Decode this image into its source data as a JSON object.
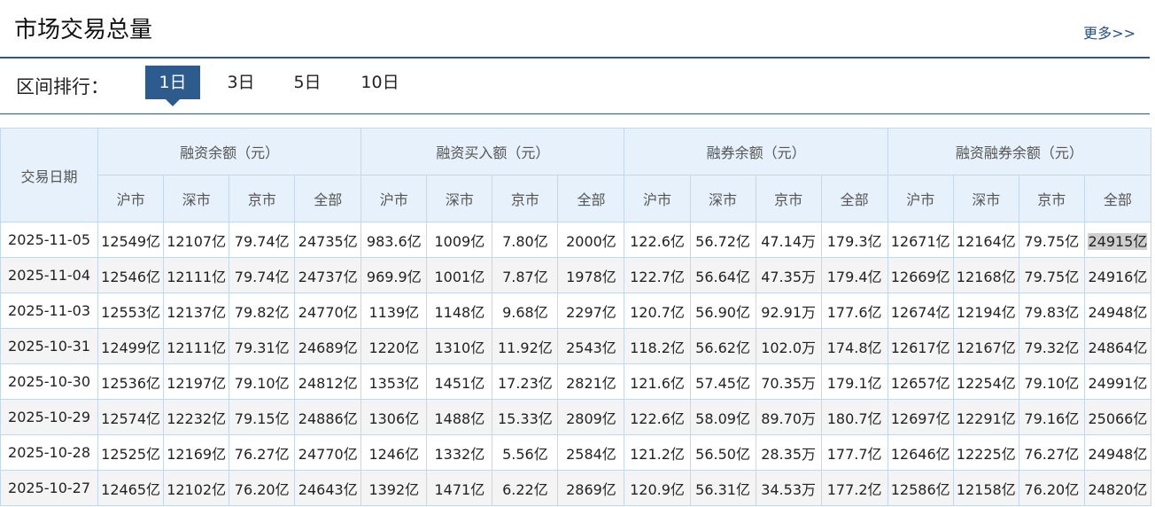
{
  "header": {
    "title": "市场交易总量",
    "more": "更多>>"
  },
  "range": {
    "label": "区间排行：",
    "tabs": [
      "1日",
      "3日",
      "5日",
      "10日"
    ],
    "active": 0
  },
  "table": {
    "date_header": "交易日期",
    "groups": [
      "融资余额（元）",
      "融资买入额（元）",
      "融券余额（元）",
      "融资融券余额（元）"
    ],
    "subheaders": [
      "沪市",
      "深市",
      "京市",
      "全部"
    ],
    "rows": [
      {
        "date": "2025-11-05",
        "values": [
          "12549亿",
          "12107亿",
          "79.74亿",
          "24735亿",
          "983.6亿",
          "1009亿",
          "7.80亿",
          "2000亿",
          "122.6亿",
          "56.72亿",
          "47.14万",
          "179.3亿",
          "12671亿",
          "12164亿",
          "79.75亿",
          "24915亿"
        ]
      },
      {
        "date": "2025-11-04",
        "values": [
          "12546亿",
          "12111亿",
          "79.74亿",
          "24737亿",
          "969.9亿",
          "1001亿",
          "7.87亿",
          "1978亿",
          "122.7亿",
          "56.64亿",
          "47.35万",
          "179.4亿",
          "12669亿",
          "12168亿",
          "79.75亿",
          "24916亿"
        ]
      },
      {
        "date": "2025-11-03",
        "values": [
          "12553亿",
          "12137亿",
          "79.82亿",
          "24770亿",
          "1139亿",
          "1148亿",
          "9.68亿",
          "2297亿",
          "120.7亿",
          "56.90亿",
          "92.91万",
          "177.6亿",
          "12674亿",
          "12194亿",
          "79.83亿",
          "24948亿"
        ]
      },
      {
        "date": "2025-10-31",
        "values": [
          "12499亿",
          "12111亿",
          "79.31亿",
          "24689亿",
          "1220亿",
          "1310亿",
          "11.92亿",
          "2543亿",
          "118.2亿",
          "56.62亿",
          "102.0万",
          "174.8亿",
          "12617亿",
          "12167亿",
          "79.32亿",
          "24864亿"
        ]
      },
      {
        "date": "2025-10-30",
        "values": [
          "12536亿",
          "12197亿",
          "79.10亿",
          "24812亿",
          "1353亿",
          "1451亿",
          "17.23亿",
          "2821亿",
          "121.6亿",
          "57.45亿",
          "70.35万",
          "179.1亿",
          "12657亿",
          "12254亿",
          "79.10亿",
          "24991亿"
        ]
      },
      {
        "date": "2025-10-29",
        "values": [
          "12574亿",
          "12232亿",
          "79.15亿",
          "24886亿",
          "1306亿",
          "1488亿",
          "15.33亿",
          "2809亿",
          "122.6亿",
          "58.09亿",
          "89.70万",
          "180.7亿",
          "12697亿",
          "12291亿",
          "79.16亿",
          "25066亿"
        ]
      },
      {
        "date": "2025-10-28",
        "values": [
          "12525亿",
          "12169亿",
          "76.27亿",
          "24770亿",
          "1246亿",
          "1332亿",
          "5.56亿",
          "2584亿",
          "121.2亿",
          "56.50亿",
          "28.35万",
          "177.7亿",
          "12646亿",
          "12225亿",
          "76.27亿",
          "24948亿"
        ]
      },
      {
        "date": "2025-10-27",
        "values": [
          "12465亿",
          "12102亿",
          "76.20亿",
          "24643亿",
          "1392亿",
          "1471亿",
          "6.22亿",
          "2869亿",
          "120.9亿",
          "56.31亿",
          "34.53万",
          "177.2亿",
          "12586亿",
          "12158亿",
          "76.20亿",
          "24820亿"
        ]
      }
    ]
  },
  "colors": {
    "accent": "#2e5b8e",
    "header_bg": "#e7f1fb",
    "border": "#c5d7ea",
    "link": "#254f8b"
  }
}
